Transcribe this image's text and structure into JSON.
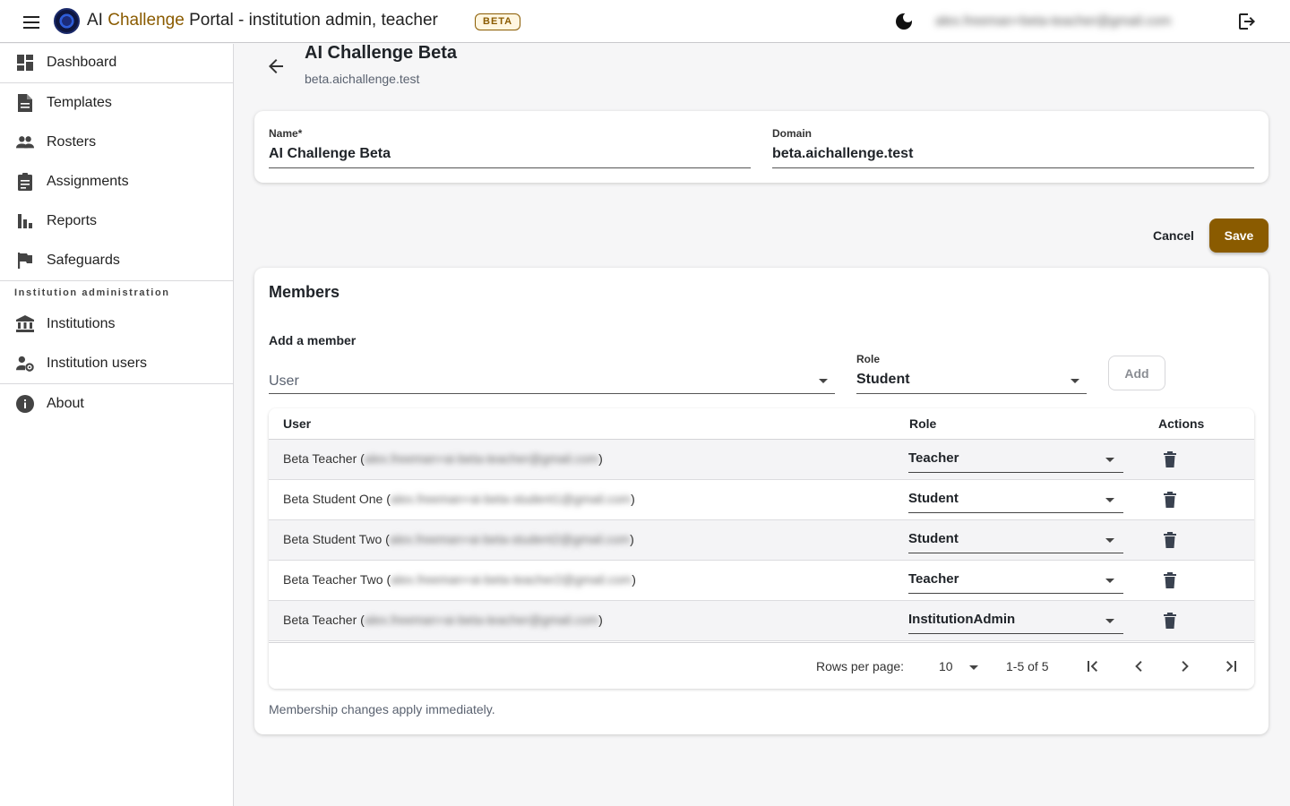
{
  "app": {
    "title_prefix": "AI ",
    "title_accent": "Challenge",
    "title_rest": " Portal - institution admin, teacher",
    "badge": "BETA",
    "user_email": "alex.freeman+beta-teacher@gmail.com",
    "brand_color": "#8a5b00"
  },
  "sidebar": {
    "items": [
      {
        "label": "Dashboard",
        "icon": "dashboard-icon"
      },
      {
        "label": "Templates",
        "icon": "document-icon"
      },
      {
        "label": "Rosters",
        "icon": "people-icon"
      },
      {
        "label": "Assignments",
        "icon": "clipboard-icon"
      },
      {
        "label": "Reports",
        "icon": "bar-chart-icon"
      },
      {
        "label": "Safeguards",
        "icon": "flag-icon"
      }
    ],
    "section_heading": "Institution administration",
    "admin_items": [
      {
        "label": "Institutions",
        "icon": "bank-icon"
      },
      {
        "label": "Institution users",
        "icon": "user-gear-icon"
      }
    ],
    "about": {
      "label": "About",
      "icon": "info-icon"
    }
  },
  "page": {
    "title": "AI Challenge Beta",
    "subtitle": "beta.aichallenge.test"
  },
  "form": {
    "name_label": "Name*",
    "name_value": "AI Challenge Beta",
    "domain_label": "Domain",
    "domain_value": "beta.aichallenge.test",
    "cancel_label": "Cancel",
    "save_label": "Save"
  },
  "members": {
    "title": "Members",
    "add_title": "Add a member",
    "user_placeholder": "User",
    "role_label": "Role",
    "role_value": "Student",
    "add_label": "Add",
    "columns": [
      "User",
      "Role",
      "Actions"
    ],
    "rows": [
      {
        "name": "Beta Teacher",
        "email": "alex.freeman+ai-beta-teacher@gmail.com",
        "role": "Teacher"
      },
      {
        "name": "Beta Student One",
        "email": "alex.freeman+ai-beta-student1@gmail.com",
        "role": "Student"
      },
      {
        "name": "Beta Student Two",
        "email": "alex.freeman+ai-beta-student2@gmail.com",
        "role": "Student"
      },
      {
        "name": "Beta Teacher Two",
        "email": "alex.freeman+ai-beta-teacher2@gmail.com",
        "role": "Teacher"
      },
      {
        "name": "Beta Teacher",
        "email": "alex.freeman+ai-beta-teacher@gmail.com",
        "role": "InstitutionAdmin"
      }
    ],
    "rows_per_page_label": "Rows per page:",
    "rows_per_page": "10",
    "range": "1-5 of 5",
    "note": "Membership changes apply immediately."
  }
}
